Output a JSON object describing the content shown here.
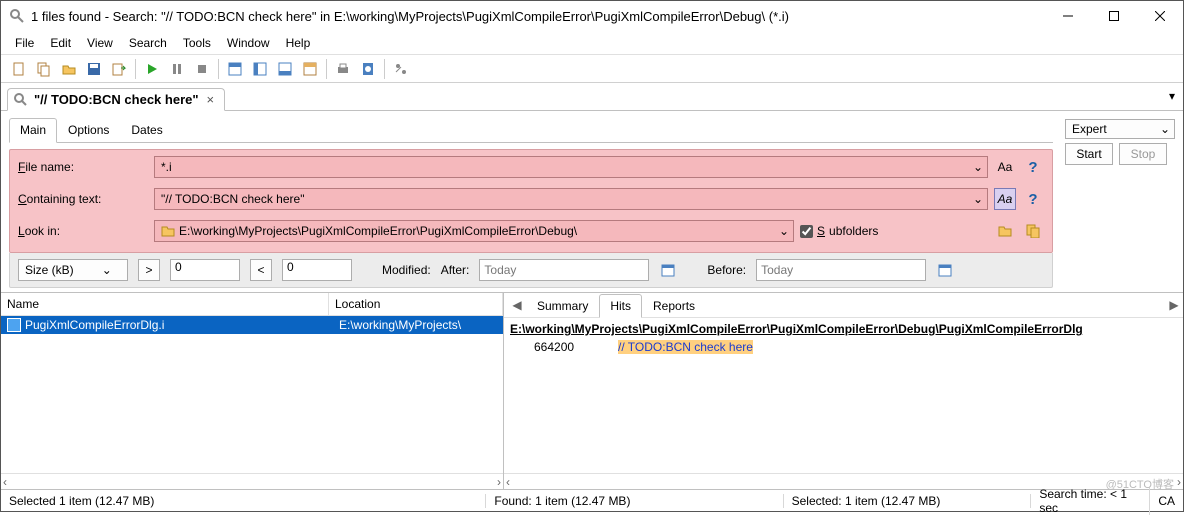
{
  "window": {
    "title": "1 files found - Search: \"// TODO:BCN check here\" in E:\\working\\MyProjects\\PugiXmlCompileError\\PugiXmlCompileError\\Debug\\ (*.i)"
  },
  "menu": {
    "items": [
      "File",
      "Edit",
      "View",
      "Search",
      "Tools",
      "Window",
      "Help"
    ]
  },
  "toolbar_icons": [
    "new",
    "copy",
    "open",
    "save",
    "export",
    "run",
    "pause",
    "stop",
    "panel1",
    "panel2",
    "panel3",
    "panel4",
    "print",
    "preview",
    "settings"
  ],
  "search_tab": {
    "label": "\"// TODO:BCN check here\"",
    "close": "×"
  },
  "subtabs": [
    "Main",
    "Options",
    "Dates"
  ],
  "form": {
    "file_name_label": "File name:",
    "file_name": "*.i",
    "containing_label": "Containing text:",
    "containing": "\"// TODO:BCN check here\"",
    "lookin_label": "Look in:",
    "lookin": "E:\\working\\MyProjects\\PugiXmlCompileError\\PugiXmlCompileError\\Debug\\",
    "subfolders_label": "Subfolders",
    "subfolders_checked": true,
    "help": "?",
    "aa": "Aa"
  },
  "filters": {
    "size_label": "Size (kB)",
    "gt": ">",
    "gt_val": "0",
    "lt": "<",
    "lt_val": "0",
    "modified": "Modified:",
    "after": "After:",
    "after_val": "Today",
    "before": "Before:",
    "before_val": "Today"
  },
  "mode": {
    "label": "Expert"
  },
  "actions": {
    "start": "Start",
    "stop": "Stop"
  },
  "results": {
    "cols": {
      "name": "Name",
      "location": "Location"
    },
    "row": {
      "name": "PugiXmlCompileErrorDlg.i",
      "location": "E:\\working\\MyProjects\\"
    }
  },
  "viewer": {
    "tabs": [
      "Summary",
      "Hits",
      "Reports"
    ],
    "active": 1,
    "path": "E:\\working\\MyProjects\\PugiXmlCompileError\\PugiXmlCompileError\\Debug\\PugiXmlCompileErrorDlg",
    "hit_line": "664200",
    "hit_text": "// TODO:BCN check here"
  },
  "status": {
    "selected": "Selected 1 item (12.47 MB)",
    "found": "Found: 1 item (12.47 MB)",
    "selected2": "Selected: 1 item (12.47 MB)",
    "time": "Search time: < 1 sec",
    "cap": "CA"
  },
  "watermark": "@51CTO博客"
}
